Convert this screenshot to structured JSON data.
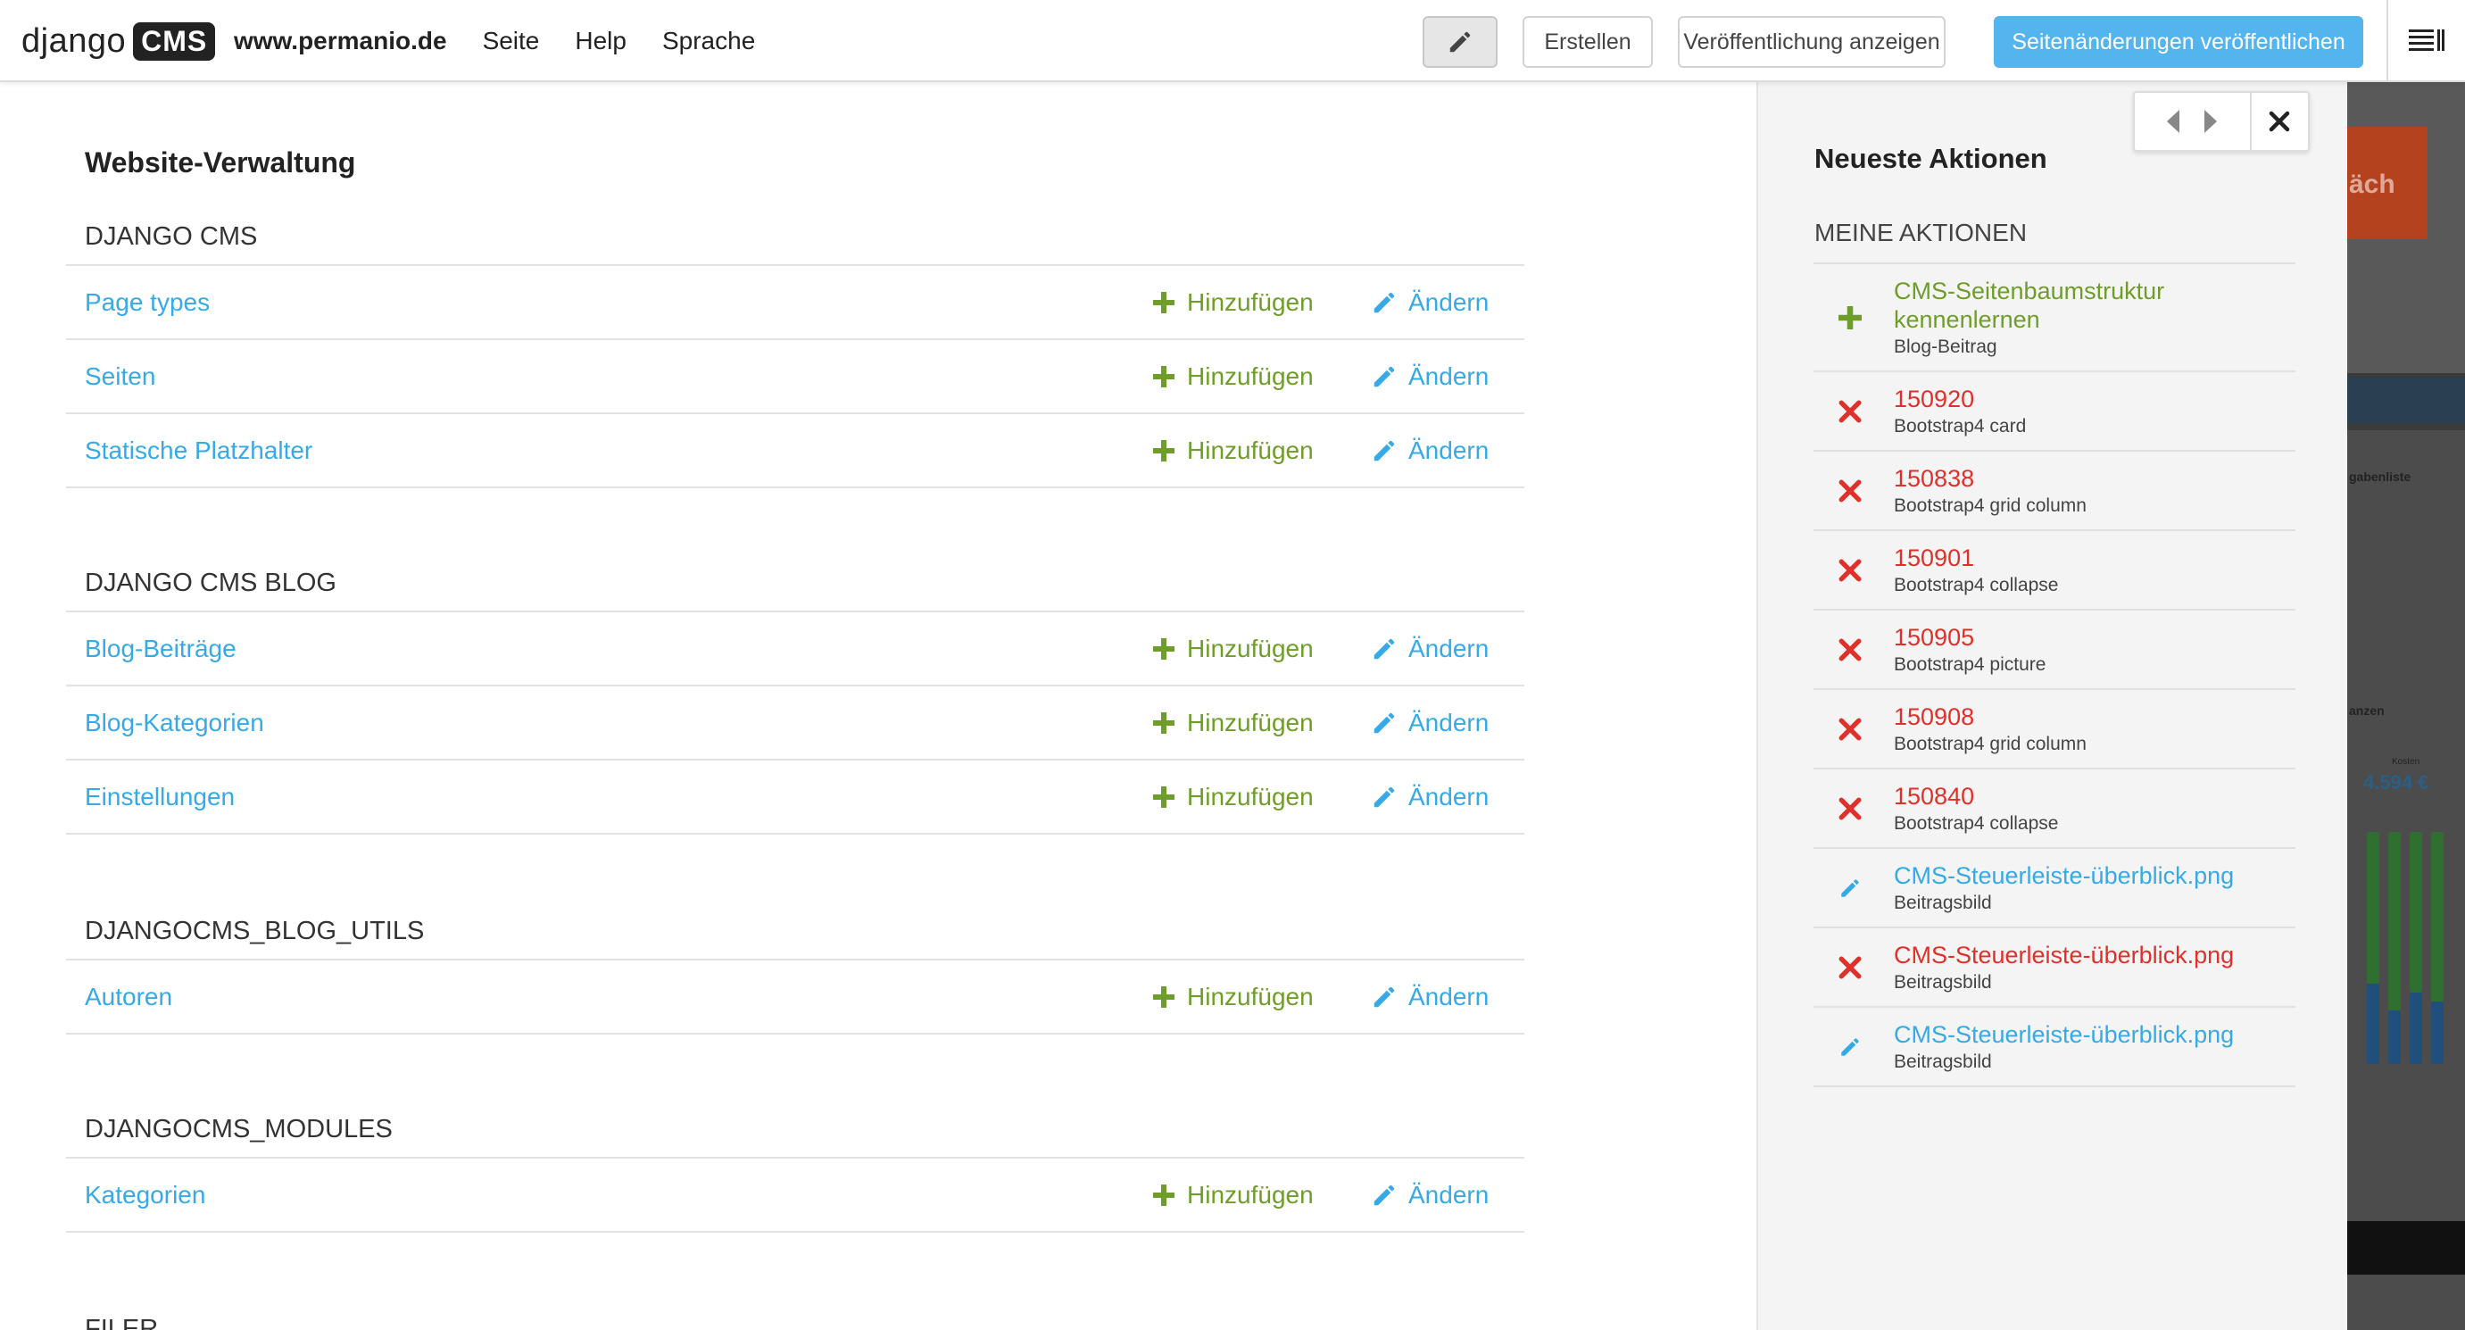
{
  "toolbar": {
    "logo_django": "django",
    "logo_cms": "CMS",
    "site": "www.permanio.de",
    "menu": [
      "Seite",
      "Help",
      "Sprache"
    ],
    "create_label": "Erstellen",
    "view_published_label": "Veröffentlichung anzeigen",
    "publish_label": "Seitenänderungen veröffentlichen"
  },
  "admin": {
    "title": "Website-Verwaltung",
    "add_label": "Hinzufügen",
    "change_label": "Ändern",
    "modules": [
      {
        "name": "DJANGO CMS",
        "rows": [
          "Page types",
          "Seiten",
          "Statische Platzhalter"
        ]
      },
      {
        "name": "DJANGO CMS BLOG",
        "rows": [
          "Blog-Beiträge",
          "Blog-Kategorien",
          "Einstellungen"
        ]
      },
      {
        "name": "DJANGOCMS_BLOG_UTILS",
        "rows": [
          "Autoren"
        ]
      },
      {
        "name": "DJANGOCMS_MODULES",
        "rows": [
          "Kategorien"
        ]
      },
      {
        "name": "FILER",
        "rows": []
      }
    ]
  },
  "sidebar": {
    "title": "Neueste Aktionen",
    "subtitle": "MEINE AKTIONEN",
    "items": [
      {
        "action": "add",
        "title": "CMS-Seitenbaumstruktur kennenlernen",
        "type": "Blog-Beitrag"
      },
      {
        "action": "delete",
        "title": "150920",
        "type": "Bootstrap4 card"
      },
      {
        "action": "delete",
        "title": "150838",
        "type": "Bootstrap4 grid column"
      },
      {
        "action": "delete",
        "title": "150901",
        "type": "Bootstrap4 collapse"
      },
      {
        "action": "delete",
        "title": "150905",
        "type": "Bootstrap4 picture"
      },
      {
        "action": "delete",
        "title": "150908",
        "type": "Bootstrap4 grid column"
      },
      {
        "action": "delete",
        "title": "150840",
        "type": "Bootstrap4 collapse"
      },
      {
        "action": "change",
        "title": "CMS-Steuerleiste-überblick.png",
        "type": "Beitragsbild"
      },
      {
        "action": "delete",
        "title": "CMS-Steuerleiste-überblick.png",
        "type": "Beitragsbild"
      },
      {
        "action": "change",
        "title": "CMS-Steuerleiste-überblick.png",
        "type": "Beitragsbild"
      }
    ]
  },
  "preview": {
    "button_fragment": "äch",
    "list_heading": "gabenliste",
    "section_label": "anzen",
    "kosten_label": "Kosten",
    "value": "4.594 €"
  },
  "colors": {
    "accent_blue": "#36a9e7",
    "publish_blue": "#54b5ee",
    "add_green": "#6f9d2a",
    "delete_red": "#e0302a"
  },
  "icons": {
    "edit": "pencil-icon",
    "add": "plus-icon",
    "delete": "cross-icon",
    "menu": "menu-lines-icon",
    "close": "close-icon",
    "prev": "chevron-left-icon",
    "next": "chevron-right-icon"
  }
}
